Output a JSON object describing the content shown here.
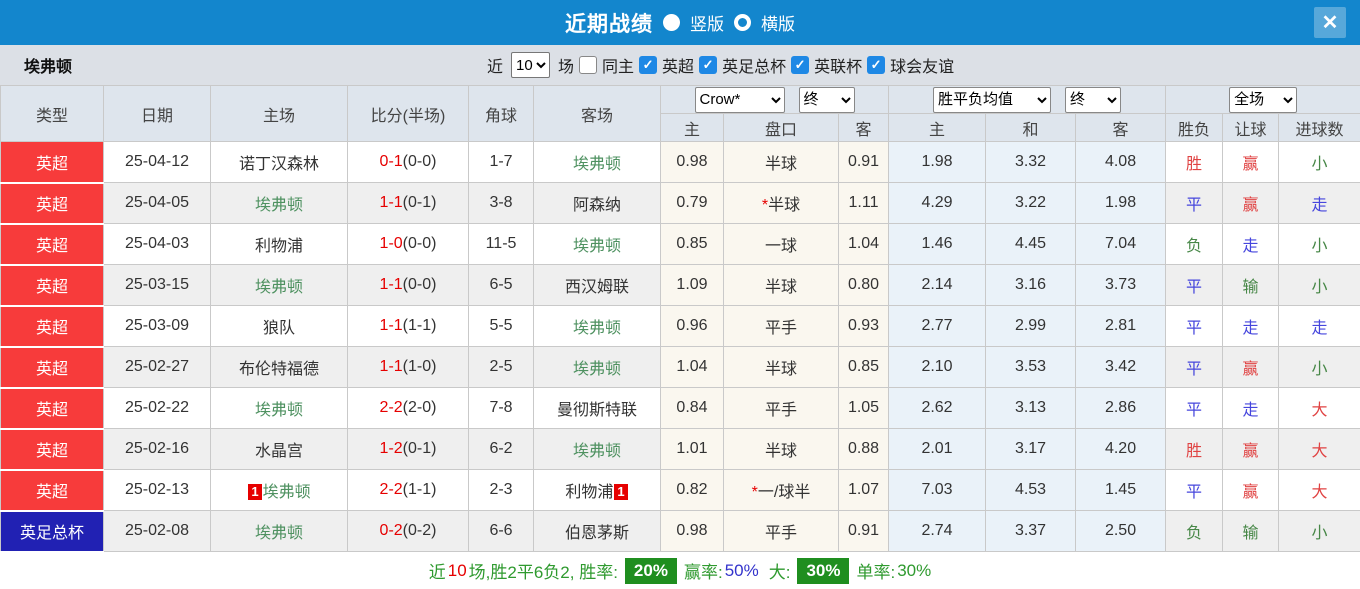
{
  "titlebar": {
    "title": "近期战绩",
    "radio_vertical": "竖版",
    "radio_horizontal": "横版",
    "close": "✕"
  },
  "filterbar": {
    "team": "埃弗顿",
    "near_label": "近",
    "count_value": "10",
    "games_label": "场",
    "same_home_label": "同主",
    "leagues": [
      "英超",
      "英足总杯",
      "英联杯",
      "球会友谊"
    ]
  },
  "table": {
    "left_headers": [
      "类型",
      "日期",
      "主场",
      "比分(半场)",
      "角球",
      "客场"
    ],
    "selects": {
      "bookmaker": "Crow*",
      "bookmaker_stage": "终",
      "avg": "胜平负均值",
      "avg_stage": "终",
      "scope": "全场"
    },
    "sub_headers": [
      "主",
      "盘口",
      "客",
      "主",
      "和",
      "客",
      "胜负",
      "让球",
      "进球数"
    ],
    "rows": [
      {
        "league": "英超",
        "league_style": "red",
        "date": "25-04-12",
        "home": "诺丁汉森林",
        "home_everton": false,
        "home_redcard": "",
        "score": "0-1",
        "half": "(0-0)",
        "corners": "1-7",
        "away": "埃弗顿",
        "away_everton": true,
        "away_redcard": "",
        "odds_home": "0.98",
        "handicap": "半球",
        "handicap_star": false,
        "odds_away": "0.91",
        "avg_home": "1.98",
        "avg_draw": "3.32",
        "avg_away": "4.08",
        "result": "胜",
        "result_c": "red",
        "let_res": "赢",
        "let_res_c": "red",
        "goals": "小",
        "goals_c": "green"
      },
      {
        "league": "英超",
        "league_style": "red",
        "date": "25-04-05",
        "home": "埃弗顿",
        "home_everton": true,
        "home_redcard": "",
        "score": "1-1",
        "half": "(0-1)",
        "corners": "3-8",
        "away": "阿森纳",
        "away_everton": false,
        "away_redcard": "",
        "odds_home": "0.79",
        "handicap": "半球",
        "handicap_star": true,
        "odds_away": "1.11",
        "avg_home": "4.29",
        "avg_draw": "3.22",
        "avg_away": "1.98",
        "result": "平",
        "result_c": "blue",
        "let_res": "赢",
        "let_res_c": "red",
        "goals": "走",
        "goals_c": "blue"
      },
      {
        "league": "英超",
        "league_style": "red",
        "date": "25-04-03",
        "home": "利物浦",
        "home_everton": false,
        "home_redcard": "",
        "score": "1-0",
        "half": "(0-0)",
        "corners": "11-5",
        "away": "埃弗顿",
        "away_everton": true,
        "away_redcard": "",
        "odds_home": "0.85",
        "handicap": "一球",
        "handicap_star": false,
        "odds_away": "1.04",
        "avg_home": "1.46",
        "avg_draw": "4.45",
        "avg_away": "7.04",
        "result": "负",
        "result_c": "green",
        "let_res": "走",
        "let_res_c": "blue",
        "goals": "小",
        "goals_c": "green"
      },
      {
        "league": "英超",
        "league_style": "red",
        "date": "25-03-15",
        "home": "埃弗顿",
        "home_everton": true,
        "home_redcard": "",
        "score": "1-1",
        "half": "(0-0)",
        "corners": "6-5",
        "away": "西汉姆联",
        "away_everton": false,
        "away_redcard": "",
        "odds_home": "1.09",
        "handicap": "半球",
        "handicap_star": false,
        "odds_away": "0.80",
        "avg_home": "2.14",
        "avg_draw": "3.16",
        "avg_away": "3.73",
        "result": "平",
        "result_c": "blue",
        "let_res": "输",
        "let_res_c": "green",
        "goals": "小",
        "goals_c": "green"
      },
      {
        "league": "英超",
        "league_style": "red",
        "date": "25-03-09",
        "home": "狼队",
        "home_everton": false,
        "home_redcard": "",
        "score": "1-1",
        "half": "(1-1)",
        "corners": "5-5",
        "away": "埃弗顿",
        "away_everton": true,
        "away_redcard": "",
        "odds_home": "0.96",
        "handicap": "平手",
        "handicap_star": false,
        "odds_away": "0.93",
        "avg_home": "2.77",
        "avg_draw": "2.99",
        "avg_away": "2.81",
        "result": "平",
        "result_c": "blue",
        "let_res": "走",
        "let_res_c": "blue",
        "goals": "走",
        "goals_c": "blue"
      },
      {
        "league": "英超",
        "league_style": "red",
        "date": "25-02-27",
        "home": "布伦特福德",
        "home_everton": false,
        "home_redcard": "",
        "score": "1-1",
        "half": "(1-0)",
        "corners": "2-5",
        "away": "埃弗顿",
        "away_everton": true,
        "away_redcard": "",
        "odds_home": "1.04",
        "handicap": "半球",
        "handicap_star": false,
        "odds_away": "0.85",
        "avg_home": "2.10",
        "avg_draw": "3.53",
        "avg_away": "3.42",
        "result": "平",
        "result_c": "blue",
        "let_res": "赢",
        "let_res_c": "red",
        "goals": "小",
        "goals_c": "green"
      },
      {
        "league": "英超",
        "league_style": "red",
        "date": "25-02-22",
        "home": "埃弗顿",
        "home_everton": true,
        "home_redcard": "",
        "score": "2-2",
        "half": "(2-0)",
        "corners": "7-8",
        "away": "曼彻斯特联",
        "away_everton": false,
        "away_redcard": "",
        "odds_home": "0.84",
        "handicap": "平手",
        "handicap_star": false,
        "odds_away": "1.05",
        "avg_home": "2.62",
        "avg_draw": "3.13",
        "avg_away": "2.86",
        "result": "平",
        "result_c": "blue",
        "let_res": "走",
        "let_res_c": "blue",
        "goals": "大",
        "goals_c": "red"
      },
      {
        "league": "英超",
        "league_style": "red",
        "date": "25-02-16",
        "home": "水晶宫",
        "home_everton": false,
        "home_redcard": "",
        "score": "1-2",
        "half": "(0-1)",
        "corners": "6-2",
        "away": "埃弗顿",
        "away_everton": true,
        "away_redcard": "",
        "odds_home": "1.01",
        "handicap": "半球",
        "handicap_star": false,
        "odds_away": "0.88",
        "avg_home": "2.01",
        "avg_draw": "3.17",
        "avg_away": "4.20",
        "result": "胜",
        "result_c": "red",
        "let_res": "赢",
        "let_res_c": "red",
        "goals": "大",
        "goals_c": "red"
      },
      {
        "league": "英超",
        "league_style": "red",
        "date": "25-02-13",
        "home": "埃弗顿",
        "home_everton": true,
        "home_redcard": "1",
        "score": "2-2",
        "half": "(1-1)",
        "corners": "2-3",
        "away": "利物浦",
        "away_everton": false,
        "away_redcard": "1",
        "odds_home": "0.82",
        "handicap": "一/球半",
        "handicap_star": true,
        "odds_away": "1.07",
        "avg_home": "7.03",
        "avg_draw": "4.53",
        "avg_away": "1.45",
        "result": "平",
        "result_c": "blue",
        "let_res": "赢",
        "let_res_c": "red",
        "goals": "大",
        "goals_c": "red"
      },
      {
        "league": "英足总杯",
        "league_style": "blue",
        "date": "25-02-08",
        "home": "埃弗顿",
        "home_everton": true,
        "home_redcard": "",
        "score": "0-2",
        "half": "(0-2)",
        "corners": "6-6",
        "away": "伯恩茅斯",
        "away_everton": false,
        "away_redcard": "",
        "odds_home": "0.98",
        "handicap": "平手",
        "handicap_star": false,
        "odds_away": "0.91",
        "avg_home": "2.74",
        "avg_draw": "3.37",
        "avg_away": "2.50",
        "result": "负",
        "result_c": "green",
        "let_res": "输",
        "let_res_c": "green",
        "goals": "小",
        "goals_c": "green"
      }
    ]
  },
  "summary": {
    "near_label": "近",
    "count": "10",
    "record_text": "场,胜2平6负2, 胜率:",
    "win_rate_badge": "20%",
    "handicap_label": "赢率:",
    "handicap_rate": "50%",
    "big_label": "大:",
    "big_badge": "30%",
    "single_label": "单率:",
    "single_rate": "30%"
  }
}
